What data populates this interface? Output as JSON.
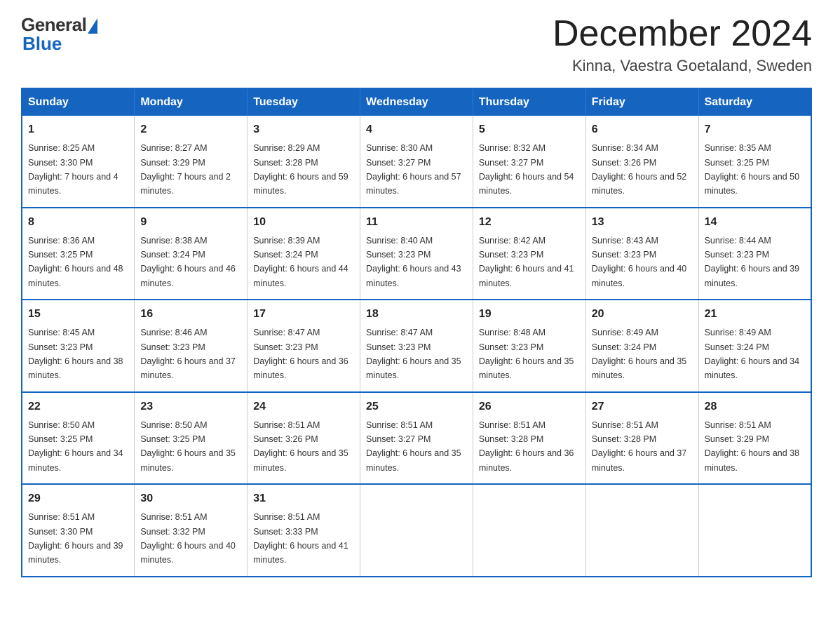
{
  "logo": {
    "general_text": "General",
    "blue_text": "Blue"
  },
  "header": {
    "month_year": "December 2024",
    "location": "Kinna, Vaestra Goetaland, Sweden"
  },
  "weekdays": [
    "Sunday",
    "Monday",
    "Tuesday",
    "Wednesday",
    "Thursday",
    "Friday",
    "Saturday"
  ],
  "weeks": [
    [
      {
        "day": "1",
        "sunrise": "8:25 AM",
        "sunset": "3:30 PM",
        "daylight": "7 hours and 4 minutes."
      },
      {
        "day": "2",
        "sunrise": "8:27 AM",
        "sunset": "3:29 PM",
        "daylight": "7 hours and 2 minutes."
      },
      {
        "day": "3",
        "sunrise": "8:29 AM",
        "sunset": "3:28 PM",
        "daylight": "6 hours and 59 minutes."
      },
      {
        "day": "4",
        "sunrise": "8:30 AM",
        "sunset": "3:27 PM",
        "daylight": "6 hours and 57 minutes."
      },
      {
        "day": "5",
        "sunrise": "8:32 AM",
        "sunset": "3:27 PM",
        "daylight": "6 hours and 54 minutes."
      },
      {
        "day": "6",
        "sunrise": "8:34 AM",
        "sunset": "3:26 PM",
        "daylight": "6 hours and 52 minutes."
      },
      {
        "day": "7",
        "sunrise": "8:35 AM",
        "sunset": "3:25 PM",
        "daylight": "6 hours and 50 minutes."
      }
    ],
    [
      {
        "day": "8",
        "sunrise": "8:36 AM",
        "sunset": "3:25 PM",
        "daylight": "6 hours and 48 minutes."
      },
      {
        "day": "9",
        "sunrise": "8:38 AM",
        "sunset": "3:24 PM",
        "daylight": "6 hours and 46 minutes."
      },
      {
        "day": "10",
        "sunrise": "8:39 AM",
        "sunset": "3:24 PM",
        "daylight": "6 hours and 44 minutes."
      },
      {
        "day": "11",
        "sunrise": "8:40 AM",
        "sunset": "3:23 PM",
        "daylight": "6 hours and 43 minutes."
      },
      {
        "day": "12",
        "sunrise": "8:42 AM",
        "sunset": "3:23 PM",
        "daylight": "6 hours and 41 minutes."
      },
      {
        "day": "13",
        "sunrise": "8:43 AM",
        "sunset": "3:23 PM",
        "daylight": "6 hours and 40 minutes."
      },
      {
        "day": "14",
        "sunrise": "8:44 AM",
        "sunset": "3:23 PM",
        "daylight": "6 hours and 39 minutes."
      }
    ],
    [
      {
        "day": "15",
        "sunrise": "8:45 AM",
        "sunset": "3:23 PM",
        "daylight": "6 hours and 38 minutes."
      },
      {
        "day": "16",
        "sunrise": "8:46 AM",
        "sunset": "3:23 PM",
        "daylight": "6 hours and 37 minutes."
      },
      {
        "day": "17",
        "sunrise": "8:47 AM",
        "sunset": "3:23 PM",
        "daylight": "6 hours and 36 minutes."
      },
      {
        "day": "18",
        "sunrise": "8:47 AM",
        "sunset": "3:23 PM",
        "daylight": "6 hours and 35 minutes."
      },
      {
        "day": "19",
        "sunrise": "8:48 AM",
        "sunset": "3:23 PM",
        "daylight": "6 hours and 35 minutes."
      },
      {
        "day": "20",
        "sunrise": "8:49 AM",
        "sunset": "3:24 PM",
        "daylight": "6 hours and 35 minutes."
      },
      {
        "day": "21",
        "sunrise": "8:49 AM",
        "sunset": "3:24 PM",
        "daylight": "6 hours and 34 minutes."
      }
    ],
    [
      {
        "day": "22",
        "sunrise": "8:50 AM",
        "sunset": "3:25 PM",
        "daylight": "6 hours and 34 minutes."
      },
      {
        "day": "23",
        "sunrise": "8:50 AM",
        "sunset": "3:25 PM",
        "daylight": "6 hours and 35 minutes."
      },
      {
        "day": "24",
        "sunrise": "8:51 AM",
        "sunset": "3:26 PM",
        "daylight": "6 hours and 35 minutes."
      },
      {
        "day": "25",
        "sunrise": "8:51 AM",
        "sunset": "3:27 PM",
        "daylight": "6 hours and 35 minutes."
      },
      {
        "day": "26",
        "sunrise": "8:51 AM",
        "sunset": "3:28 PM",
        "daylight": "6 hours and 36 minutes."
      },
      {
        "day": "27",
        "sunrise": "8:51 AM",
        "sunset": "3:28 PM",
        "daylight": "6 hours and 37 minutes."
      },
      {
        "day": "28",
        "sunrise": "8:51 AM",
        "sunset": "3:29 PM",
        "daylight": "6 hours and 38 minutes."
      }
    ],
    [
      {
        "day": "29",
        "sunrise": "8:51 AM",
        "sunset": "3:30 PM",
        "daylight": "6 hours and 39 minutes."
      },
      {
        "day": "30",
        "sunrise": "8:51 AM",
        "sunset": "3:32 PM",
        "daylight": "6 hours and 40 minutes."
      },
      {
        "day": "31",
        "sunrise": "8:51 AM",
        "sunset": "3:33 PM",
        "daylight": "6 hours and 41 minutes."
      },
      null,
      null,
      null,
      null
    ]
  ]
}
